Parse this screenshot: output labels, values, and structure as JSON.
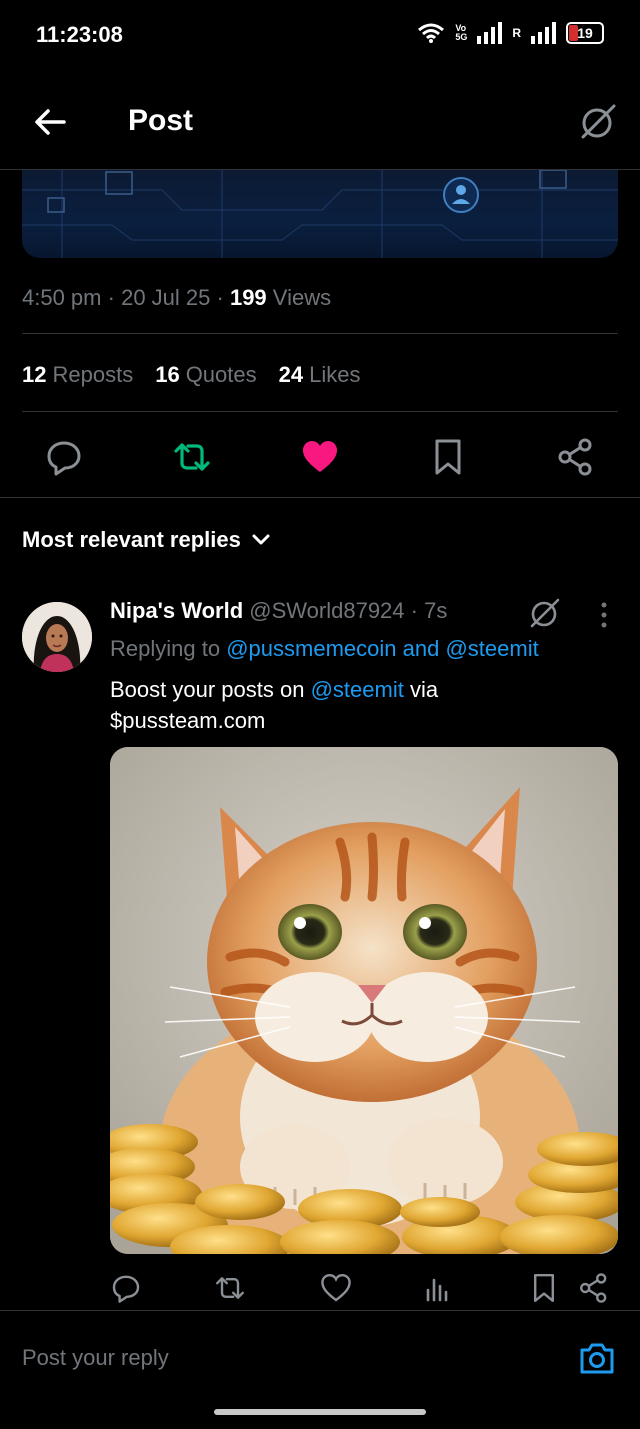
{
  "status_bar": {
    "time": "11:23:08",
    "network_top": "Vo",
    "network_bottom": "5G",
    "roaming": "R",
    "battery": "19"
  },
  "header": {
    "title": "Post",
    "back_icon": "arrow-left-icon",
    "grok_icon": "grok-icon"
  },
  "post": {
    "time": "4:50 pm",
    "date": "20 Jul 25",
    "views_count": "199",
    "views_label": "Views",
    "reposts_count": "12",
    "reposts_label": "Reposts",
    "quotes_count": "16",
    "quotes_label": "Quotes",
    "likes_count": "24",
    "likes_label": "Likes",
    "liked": true,
    "reposted": true
  },
  "colors": {
    "accent": "#1d9bf0",
    "like": "#f91880",
    "repost": "#00ba7c",
    "muted": "#71767b"
  },
  "replies_sort": {
    "label": "Most relevant replies"
  },
  "reply": {
    "name": "Nipa's World",
    "handle": "@SWorld87924",
    "age": "7s",
    "replying_prefix": "Replying to",
    "replying_user1": "@pussmemecoin",
    "replying_and": "and",
    "replying_user2": "@steemit",
    "text_part1": "Boost your posts on",
    "text_mention": "@steemit",
    "text_part2": "via",
    "text_line2": "$pussteam.com"
  },
  "composer": {
    "placeholder": "Post your reply"
  }
}
